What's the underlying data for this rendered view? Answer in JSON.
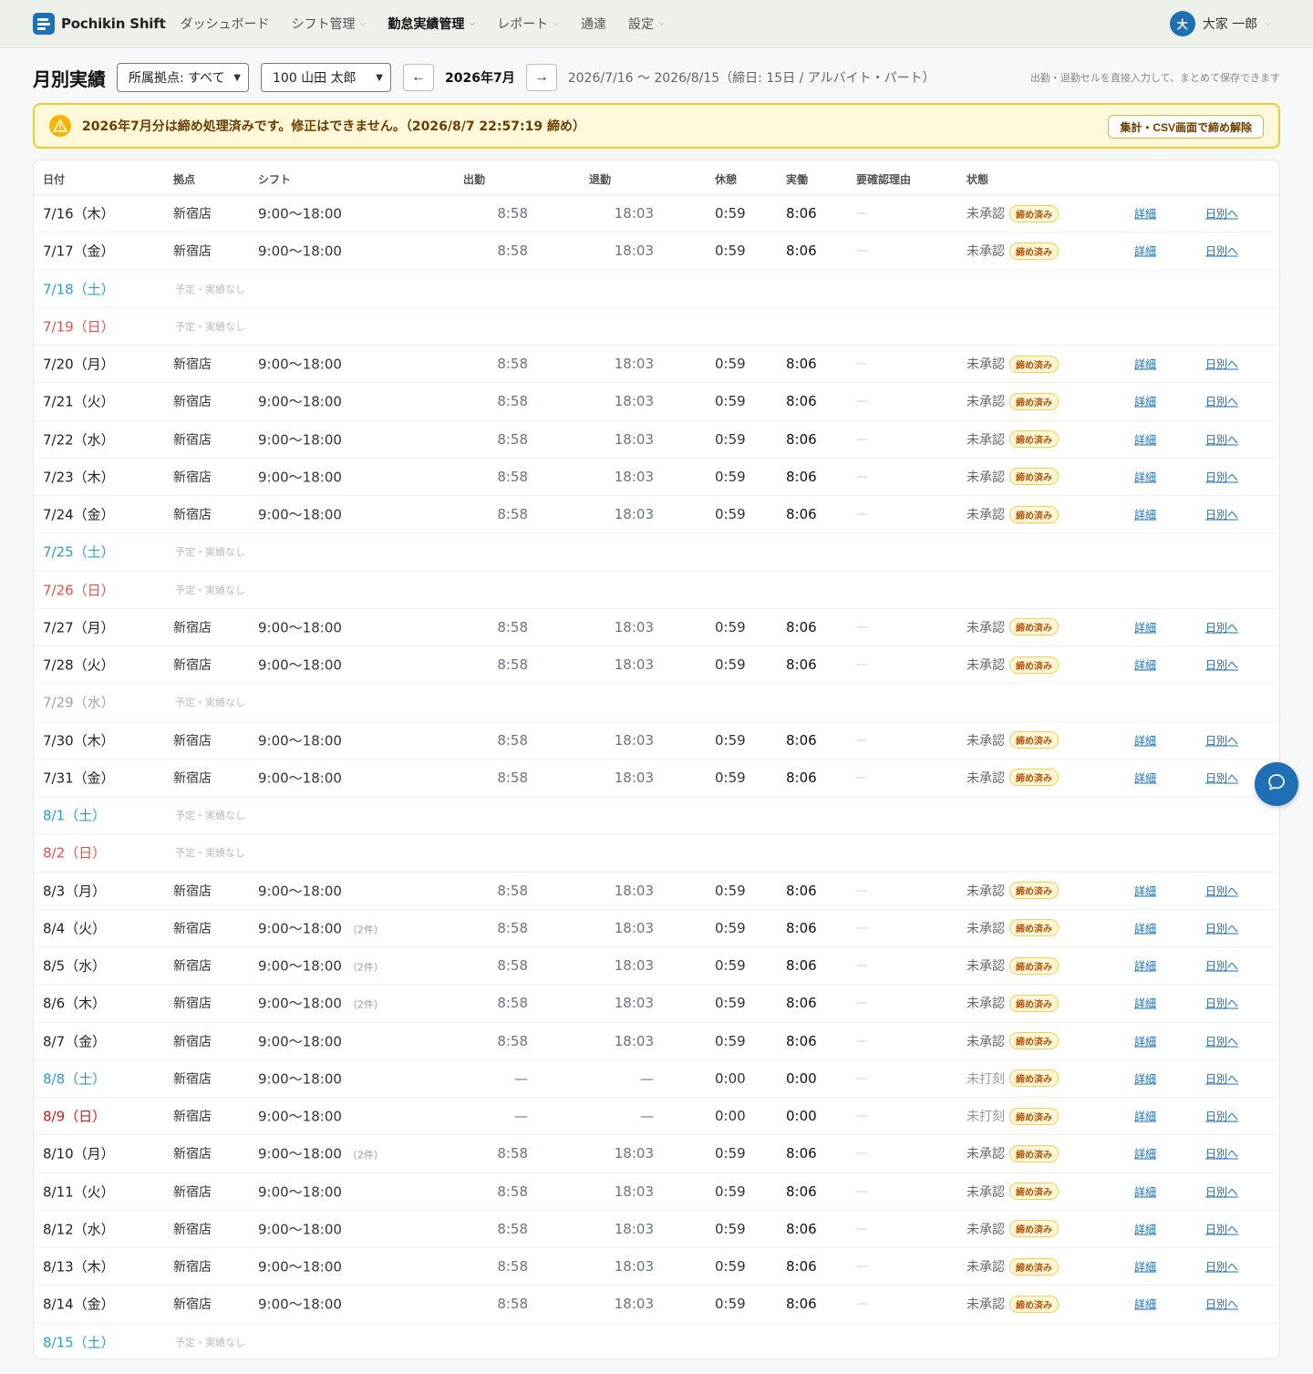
{
  "app": {
    "name": "Pochikin Shift"
  },
  "nav": [
    {
      "label": "ダッシュボード",
      "dropdown": false,
      "active": false
    },
    {
      "label": "シフト管理",
      "dropdown": true,
      "active": false
    },
    {
      "label": "勤怠実績管理",
      "dropdown": true,
      "active": true
    },
    {
      "label": "レポート",
      "dropdown": true,
      "active": false
    },
    {
      "label": "通達",
      "dropdown": false,
      "active": false
    },
    {
      "label": "設定",
      "dropdown": true,
      "active": false
    }
  ],
  "user": {
    "avatar": "大",
    "name": "大家 一郎"
  },
  "toolbar": {
    "title": "月別実績",
    "site_select": "所属拠点: すべて",
    "staff_select": "100 山田 太郎",
    "prev": "←",
    "month": "2026年7月",
    "next": "→",
    "range": "2026/7/16 〜 2026/8/15（締日: 15日 / アルバイト・パート）",
    "hint": "出勤・退勤セルを直接入力して、まとめて保存できます"
  },
  "alert": {
    "text": "2026年7月分は締め処理済みです。修正はできません。（2026/8/7 22:57:19 締め）",
    "button": "集計・CSV画面で締め解除"
  },
  "table": {
    "headers": {
      "date": "日付",
      "site": "拠点",
      "shift": "シフト",
      "in": "出勤",
      "out": "退勤",
      "break": "休憩",
      "actual": "実働",
      "reason": "要確認理由",
      "status": "状態"
    },
    "badge": "締め済み",
    "detail_label": "詳細",
    "daily_label": "日別へ",
    "nodata_label": "予定・実績なし",
    "rows": [
      {
        "date": "7/16（木）",
        "day": "weekday",
        "site": "新宿店",
        "shift": "9:00〜18:00",
        "count": "",
        "in": "8:58",
        "out": "18:03",
        "break": "0:59",
        "actual": "8:06",
        "reason": "—",
        "status": "未承認"
      },
      {
        "date": "7/17（金）",
        "day": "weekday",
        "site": "新宿店",
        "shift": "9:00〜18:00",
        "count": "",
        "in": "8:58",
        "out": "18:03",
        "break": "0:59",
        "actual": "8:06",
        "reason": "—",
        "status": "未承認"
      },
      {
        "date": "7/18（土）",
        "day": "sat",
        "empty": true
      },
      {
        "date": "7/19（日）",
        "day": "sun",
        "empty": true
      },
      {
        "date": "7/20（月）",
        "day": "weekday",
        "site": "新宿店",
        "shift": "9:00〜18:00",
        "count": "",
        "in": "8:58",
        "out": "18:03",
        "break": "0:59",
        "actual": "8:06",
        "reason": "—",
        "status": "未承認"
      },
      {
        "date": "7/21（火）",
        "day": "weekday",
        "site": "新宿店",
        "shift": "9:00〜18:00",
        "count": "",
        "in": "8:58",
        "out": "18:03",
        "break": "0:59",
        "actual": "8:06",
        "reason": "—",
        "status": "未承認"
      },
      {
        "date": "7/22（水）",
        "day": "weekday",
        "site": "新宿店",
        "shift": "9:00〜18:00",
        "count": "",
        "in": "8:58",
        "out": "18:03",
        "break": "0:59",
        "actual": "8:06",
        "reason": "—",
        "status": "未承認"
      },
      {
        "date": "7/23（木）",
        "day": "weekday",
        "site": "新宿店",
        "shift": "9:00〜18:00",
        "count": "",
        "in": "8:58",
        "out": "18:03",
        "break": "0:59",
        "actual": "8:06",
        "reason": "—",
        "status": "未承認"
      },
      {
        "date": "7/24（金）",
        "day": "weekday",
        "site": "新宿店",
        "shift": "9:00〜18:00",
        "count": "",
        "in": "8:58",
        "out": "18:03",
        "break": "0:59",
        "actual": "8:06",
        "reason": "—",
        "status": "未承認"
      },
      {
        "date": "7/25（土）",
        "day": "sat",
        "empty": true
      },
      {
        "date": "7/26（日）",
        "day": "sun",
        "empty": true
      },
      {
        "date": "7/27（月）",
        "day": "weekday",
        "site": "新宿店",
        "shift": "9:00〜18:00",
        "count": "",
        "in": "8:58",
        "out": "18:03",
        "break": "0:59",
        "actual": "8:06",
        "reason": "—",
        "status": "未承認"
      },
      {
        "date": "7/28（火）",
        "day": "weekday",
        "site": "新宿店",
        "shift": "9:00〜18:00",
        "count": "",
        "in": "8:58",
        "out": "18:03",
        "break": "0:59",
        "actual": "8:06",
        "reason": "—",
        "status": "未承認"
      },
      {
        "date": "7/29（水）",
        "day": "muted",
        "empty": true
      },
      {
        "date": "7/30（木）",
        "day": "weekday",
        "site": "新宿店",
        "shift": "9:00〜18:00",
        "count": "",
        "in": "8:58",
        "out": "18:03",
        "break": "0:59",
        "actual": "8:06",
        "reason": "—",
        "status": "未承認"
      },
      {
        "date": "7/31（金）",
        "day": "weekday",
        "site": "新宿店",
        "shift": "9:00〜18:00",
        "count": "",
        "in": "8:58",
        "out": "18:03",
        "break": "0:59",
        "actual": "8:06",
        "reason": "—",
        "status": "未承認"
      },
      {
        "date": "8/1（土）",
        "day": "sat",
        "empty": true
      },
      {
        "date": "8/2（日）",
        "day": "sun",
        "empty": true
      },
      {
        "date": "8/3（月）",
        "day": "weekday",
        "site": "新宿店",
        "shift": "9:00〜18:00",
        "count": "",
        "in": "8:58",
        "out": "18:03",
        "break": "0:59",
        "actual": "8:06",
        "reason": "—",
        "status": "未承認"
      },
      {
        "date": "8/4（火）",
        "day": "weekday",
        "site": "新宿店",
        "shift": "9:00〜18:00",
        "count": "（2件）",
        "in": "8:58",
        "out": "18:03",
        "break": "0:59",
        "actual": "8:06",
        "reason": "—",
        "status": "未承認"
      },
      {
        "date": "8/5（水）",
        "day": "weekday",
        "site": "新宿店",
        "shift": "9:00〜18:00",
        "count": "（2件）",
        "in": "8:58",
        "out": "18:03",
        "break": "0:59",
        "actual": "8:06",
        "reason": "—",
        "status": "未承認"
      },
      {
        "date": "8/6（木）",
        "day": "weekday",
        "site": "新宿店",
        "shift": "9:00〜18:00",
        "count": "（2件）",
        "in": "8:58",
        "out": "18:03",
        "break": "0:59",
        "actual": "8:06",
        "reason": "—",
        "status": "未承認"
      },
      {
        "date": "8/7（金）",
        "day": "weekday",
        "site": "新宿店",
        "shift": "9:00〜18:00",
        "count": "",
        "in": "8:58",
        "out": "18:03",
        "break": "0:59",
        "actual": "8:06",
        "reason": "—",
        "status": "未承認"
      },
      {
        "date": "8/8（土）",
        "day": "sat",
        "site": "新宿店",
        "shift": "9:00〜18:00",
        "count": "",
        "in": "—",
        "out": "—",
        "break": "0:00",
        "actual": "0:00",
        "reason": "—",
        "status": "未打刻",
        "status_muted": true
      },
      {
        "date": "8/9（日）",
        "day": "sun-strong",
        "site": "新宿店",
        "shift": "9:00〜18:00",
        "count": "",
        "in": "—",
        "out": "—",
        "break": "0:00",
        "actual": "0:00",
        "reason": "—",
        "status": "未打刻",
        "status_muted": true
      },
      {
        "date": "8/10（月）",
        "day": "weekday",
        "site": "新宿店",
        "shift": "9:00〜18:00",
        "count": "（2件）",
        "in": "8:58",
        "out": "18:03",
        "break": "0:59",
        "actual": "8:06",
        "reason": "—",
        "status": "未承認"
      },
      {
        "date": "8/11（火）",
        "day": "weekday",
        "site": "新宿店",
        "shift": "9:00〜18:00",
        "count": "",
        "in": "8:58",
        "out": "18:03",
        "break": "0:59",
        "actual": "8:06",
        "reason": "—",
        "status": "未承認"
      },
      {
        "date": "8/12（水）",
        "day": "weekday",
        "site": "新宿店",
        "shift": "9:00〜18:00",
        "count": "",
        "in": "8:58",
        "out": "18:03",
        "break": "0:59",
        "actual": "8:06",
        "reason": "—",
        "status": "未承認"
      },
      {
        "date": "8/13（木）",
        "day": "weekday",
        "site": "新宿店",
        "shift": "9:00〜18:00",
        "count": "",
        "in": "8:58",
        "out": "18:03",
        "break": "0:59",
        "actual": "8:06",
        "reason": "—",
        "status": "未承認"
      },
      {
        "date": "8/14（金）",
        "day": "weekday",
        "site": "新宿店",
        "shift": "9:00〜18:00",
        "count": "",
        "in": "8:58",
        "out": "18:03",
        "break": "0:59",
        "actual": "8:06",
        "reason": "—",
        "status": "未承認"
      },
      {
        "date": "8/15（土）",
        "day": "sat",
        "empty": true
      }
    ]
  },
  "icons": {
    "warning": "warning-icon",
    "chat": "chat-icon",
    "logo": "logo-icon"
  },
  "colors": {
    "brand": "#1f6fb4",
    "saturday": "#2a9dc7",
    "sunday": "#e0544e",
    "warning_bg": "#fff8db",
    "warning_border": "#f3ca2e"
  }
}
